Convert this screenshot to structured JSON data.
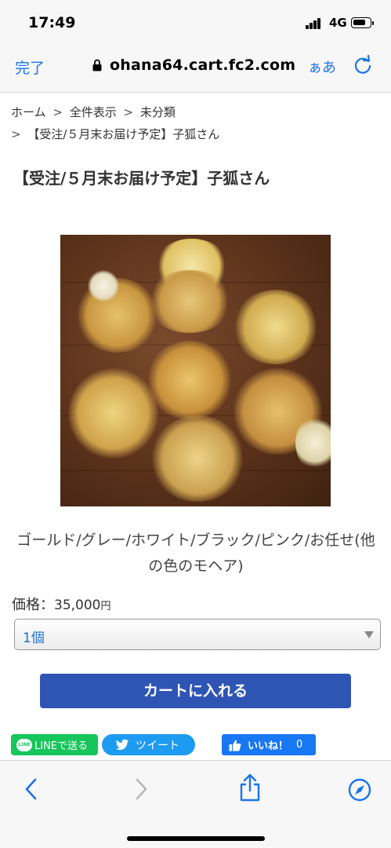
{
  "status_bar": {
    "time": "17:49",
    "network": "4G"
  },
  "browser": {
    "done_label": "完了",
    "url": "ohana64.cart.fc2.com",
    "text_size_label": "ぁあ",
    "accent_color": "#1a73e8",
    "icons": [
      "lock-icon",
      "reload-icon"
    ]
  },
  "breadcrumb": {
    "items": [
      "ホーム",
      "全件表示",
      "未分類",
      "【受注/５月末お届け予定】子狐さん"
    ],
    "separator": ">"
  },
  "product": {
    "title": "【受注/５月末お届け予定】子狐さん",
    "image_alt": "fox-plush-photo",
    "variants": "ゴールド/グレー/ホワイト/ブラック/ピンク/お任せ(他の色のモヘア)",
    "price_label": "価格：",
    "price_value": "35,000",
    "price_unit": "円",
    "quantity_selected": "1個",
    "cart_button_label": "カートに入れる",
    "cart_button_color": "#2e55b4"
  },
  "social": {
    "line_label": "LINEで送る",
    "line_icon_text": "LINE",
    "tweet_label": "ツイート",
    "like_label": "いいね！",
    "like_count": "0"
  },
  "toolbar": {
    "icons": [
      "back-icon",
      "forward-icon",
      "share-icon",
      "compass-icon"
    ]
  }
}
